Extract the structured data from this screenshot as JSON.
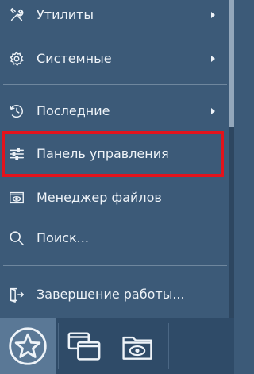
{
  "menu": {
    "items": [
      {
        "label": "Утилиты",
        "icon": "tools-icon",
        "has_submenu": true
      },
      {
        "label": "Системные",
        "icon": "gear-icon",
        "has_submenu": true
      },
      {
        "label": "Последние",
        "icon": "clock-icon",
        "has_submenu": true
      },
      {
        "label": "Панель управления",
        "icon": "sliders-icon",
        "has_submenu": false
      },
      {
        "label": "Менеджер файлов",
        "icon": "file-manager-icon",
        "has_submenu": false
      },
      {
        "label": "Поиск...",
        "icon": "search-icon",
        "has_submenu": false
      },
      {
        "label": "Завершение работы...",
        "icon": "logout-icon",
        "has_submenu": false
      }
    ],
    "highlighted_item": "Панель управления"
  },
  "taskbar": {
    "buttons": [
      "start-menu",
      "window-switcher",
      "file-manager"
    ]
  },
  "colors": {
    "menu_bg": "#3c5a78",
    "text": "#eef3f8",
    "highlight": "#e3131c",
    "taskbar_bg": "#2f4b68"
  }
}
